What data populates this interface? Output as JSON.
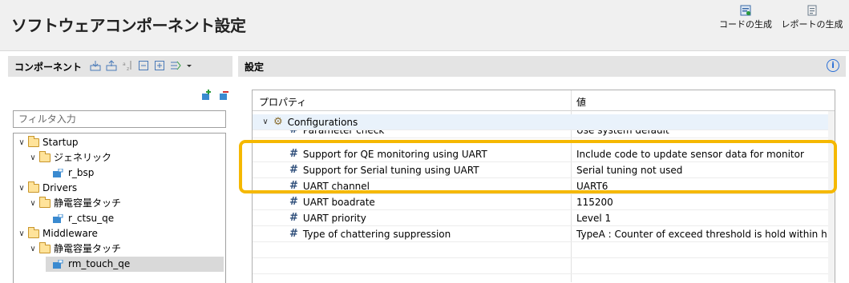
{
  "titlebar": {
    "title": "ソフトウェアコンポーネント設定",
    "generate_code": "コードの生成",
    "generate_report": "レポートの生成"
  },
  "left": {
    "title": "コンポーネント",
    "filter_placeholder": "フィルタ入力",
    "tree": [
      {
        "label": "Startup",
        "type": "folder",
        "level": 0
      },
      {
        "label": "ジェネリック",
        "type": "folder",
        "level": 1
      },
      {
        "label": "r_bsp",
        "type": "component",
        "level": 2
      },
      {
        "label": "Drivers",
        "type": "folder",
        "level": 0
      },
      {
        "label": "静電容量タッチ",
        "type": "folder",
        "level": 1
      },
      {
        "label": "r_ctsu_qe",
        "type": "component",
        "level": 2
      },
      {
        "label": "Middleware",
        "type": "folder",
        "level": 0
      },
      {
        "label": "静電容量タッチ",
        "type": "folder",
        "level": 1
      },
      {
        "label": "rm_touch_qe",
        "type": "component",
        "level": 2,
        "selected": true
      }
    ]
  },
  "right": {
    "title": "設定",
    "columns": {
      "property": "プロパティ",
      "value": "値"
    },
    "group": "Configurations",
    "rows": [
      {
        "name": "Parameter check",
        "value": "Use system default"
      },
      {
        "name": "Support for QE monitoring using UART",
        "value": "Include code to update sensor data for monitor"
      },
      {
        "name": "Support for Serial tuning using UART",
        "value": "Serial tuning not used"
      },
      {
        "name": "UART channel",
        "value": "UART6"
      },
      {
        "name": "UART boadrate",
        "value": "115200"
      },
      {
        "name": "UART priority",
        "value": "Level 1"
      },
      {
        "name": "Type of chattering suppression",
        "value": "TypeA : Counter of exceed threshold is hold within h"
      }
    ]
  },
  "colors": {
    "highlight": "#f5b800",
    "selected_row": "#e9f2fb",
    "accent": "#2a6fd6"
  }
}
